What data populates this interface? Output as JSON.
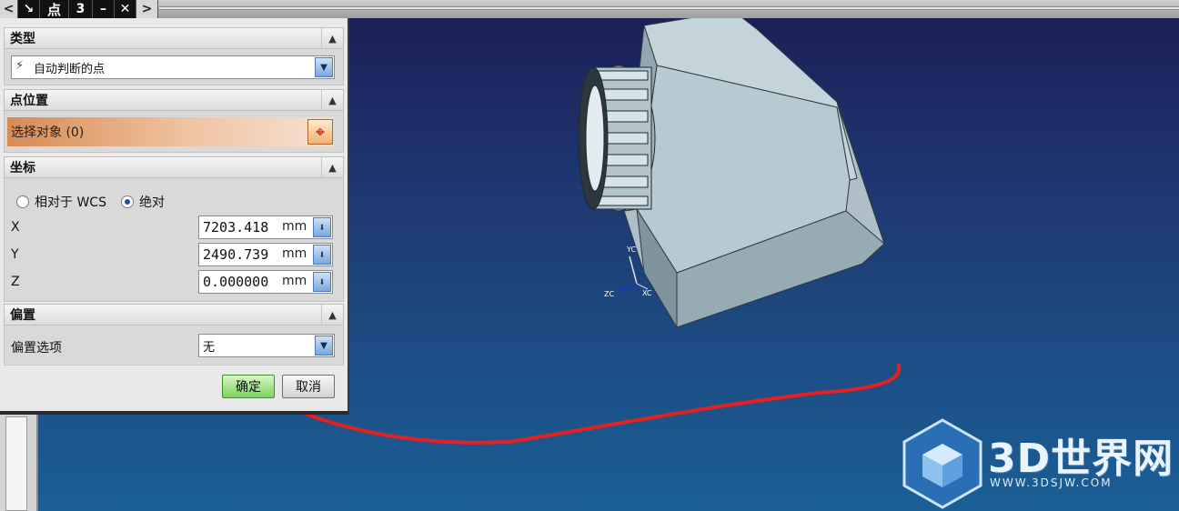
{
  "toolbar": {
    "title": "点",
    "left_arrow": "<",
    "right_arrow": ">",
    "minimize": "–",
    "close": "✕",
    "pin": "↘",
    "reset": "3"
  },
  "dialog": {
    "type_section": {
      "header": "类型",
      "value": "自动判断的点"
    },
    "position_section": {
      "header": "点位置",
      "select_object": "选择对象 (0)"
    },
    "coords_section": {
      "header": "坐标",
      "radio_relative": "相对于 WCS",
      "radio_absolute": "绝对",
      "selected": "绝对",
      "x_label": "X",
      "x_value": "7203.418",
      "x_unit": "mm",
      "y_label": "Y",
      "y_value": "2490.739",
      "y_unit": "mm",
      "z_label": "Z",
      "z_value": "0.000000",
      "z_unit": "mm"
    },
    "offset_section": {
      "header": "偏置",
      "option_label": "偏置选项",
      "option_value": "无"
    },
    "ok_label": "确定",
    "cancel_label": "取消"
  },
  "viewport": {
    "axis_labels": {
      "yc": "YC",
      "xc": "XC",
      "zc": "ZC"
    }
  },
  "watermark": {
    "logo": "3D世界网",
    "url": "WWW.3DSJW.COM"
  },
  "colors": {
    "background_top": "#1b1d55",
    "background_bottom": "#1a5f95",
    "model_face": "#b9cbd3",
    "annotation": "#e62020",
    "ok_button": "#7bd35e"
  }
}
